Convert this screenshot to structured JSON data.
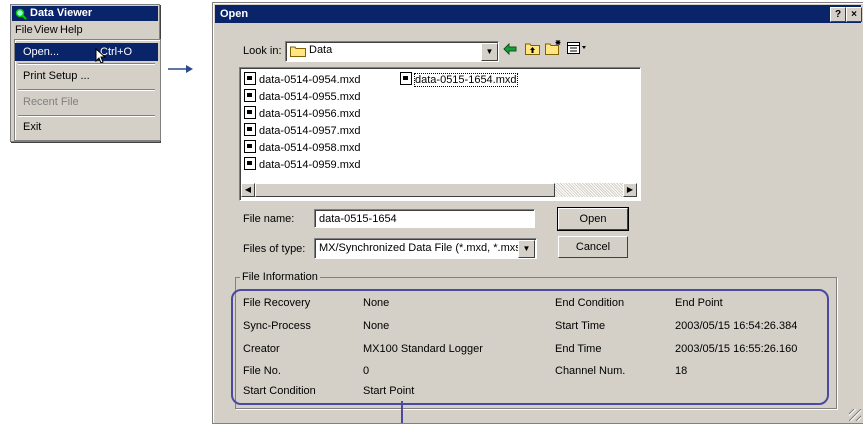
{
  "mini_window": {
    "title": "Data Viewer",
    "menu": [
      "File",
      "View",
      "Help"
    ],
    "dropdown": {
      "items": [
        {
          "label": "Open...",
          "shortcut": "Ctrl+O"
        },
        {
          "label": "Print Setup ..."
        },
        {
          "label": "Recent File"
        },
        {
          "label": "Exit"
        }
      ]
    }
  },
  "dialog": {
    "title": "Open",
    "help_button": "?",
    "close_button": "×",
    "look_in_label": "Look in:",
    "look_in_value": "Data",
    "files": [
      "data-0514-0954.mxd",
      "data-0514-0955.mxd",
      "data-0514-0956.mxd",
      "data-0514-0957.mxd",
      "data-0514-0958.mxd",
      "data-0514-0959.mxd",
      "data-0515-1654.mxd"
    ],
    "file_name_label": "File name:",
    "file_name_value": "data-0515-1654",
    "files_of_type_label": "Files of type:",
    "files_of_type_value": "MX/Synchronized Data File (*.mxd, *.mxs)",
    "open_button": "Open",
    "cancel_button": "Cancel",
    "file_info": {
      "title": "File Information",
      "left": [
        {
          "label": "File Recovery",
          "value": "None"
        },
        {
          "label": "Sync-Process",
          "value": "None"
        },
        {
          "label": "Creator",
          "value": "MX100 Standard Logger"
        },
        {
          "label": "File No.",
          "value": "0"
        },
        {
          "label": "Start Condition",
          "value": "Start Point"
        }
      ],
      "right": [
        {
          "label": "End Condition",
          "value": "End Point"
        },
        {
          "label": "Start Time",
          "value": "2003/05/15 16:54:26.384"
        },
        {
          "label": "End Time",
          "value": "2003/05/15 16:55:26.160"
        },
        {
          "label": "Channel Num.",
          "value": "18"
        }
      ]
    }
  }
}
